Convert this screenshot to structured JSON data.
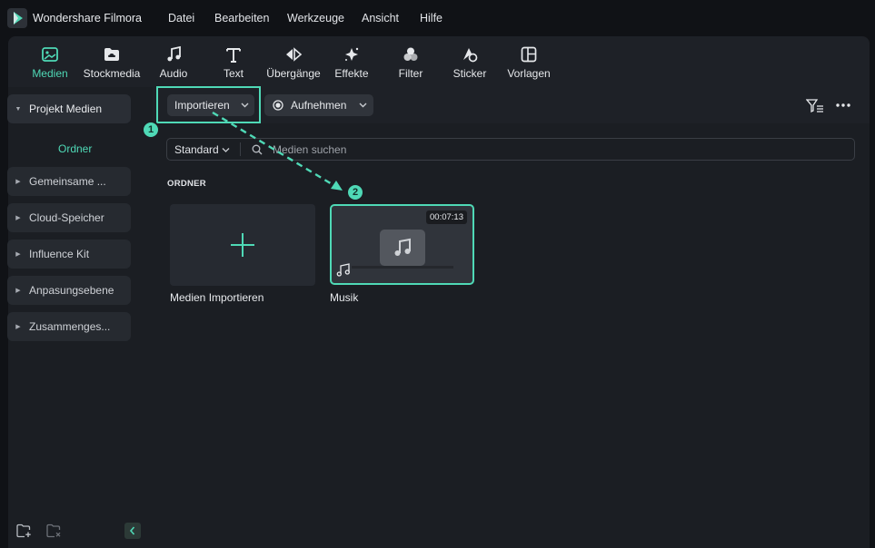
{
  "app": {
    "title": "Wondershare Filmora"
  },
  "menu": [
    "Datei",
    "Bearbeiten",
    "Werkzeuge",
    "Ansicht",
    "Hilfe"
  ],
  "toolbar": {
    "tabs": [
      {
        "label": "Medien",
        "icon": "media-icon",
        "active": true
      },
      {
        "label": "Stockmedia",
        "icon": "cloud-folder-icon",
        "active": false
      },
      {
        "label": "Audio",
        "icon": "music-note-icon",
        "active": false
      },
      {
        "label": "Text",
        "icon": "text-icon",
        "active": false
      },
      {
        "label": "Übergänge",
        "icon": "transition-icon",
        "active": false
      },
      {
        "label": "Effekte",
        "icon": "sparkle-icon",
        "active": false
      },
      {
        "label": "Filter",
        "icon": "filter-circles-icon",
        "active": false
      },
      {
        "label": "Sticker",
        "icon": "sticker-icon",
        "active": false
      },
      {
        "label": "Vorlagen",
        "icon": "template-icon",
        "active": false
      }
    ]
  },
  "sidebar": {
    "items": [
      {
        "label": "Projekt Medien",
        "expanded": true
      },
      {
        "label": "Gemeinsame ...",
        "expanded": false
      },
      {
        "label": "Cloud-Speicher",
        "expanded": false
      },
      {
        "label": "Influence Kit",
        "expanded": false
      },
      {
        "label": "Anpasungsebene",
        "expanded": false
      },
      {
        "label": "Zusammenges...",
        "expanded": false
      }
    ],
    "sub_item": "Ordner"
  },
  "content": {
    "import_button": "Importieren",
    "record_button": "Aufnehmen",
    "sort_select": "Standard",
    "search_placeholder": "Medien suchen",
    "section_title": "ORDNER",
    "cards": [
      {
        "label": "Medien Importieren",
        "type": "import"
      },
      {
        "label": "Musik",
        "type": "audio",
        "duration": "00:07:13"
      }
    ],
    "steps": [
      "1",
      "2"
    ]
  },
  "colors": {
    "accent": "#4fd9b6",
    "background": "#101216",
    "panel": "#1b1e23"
  }
}
